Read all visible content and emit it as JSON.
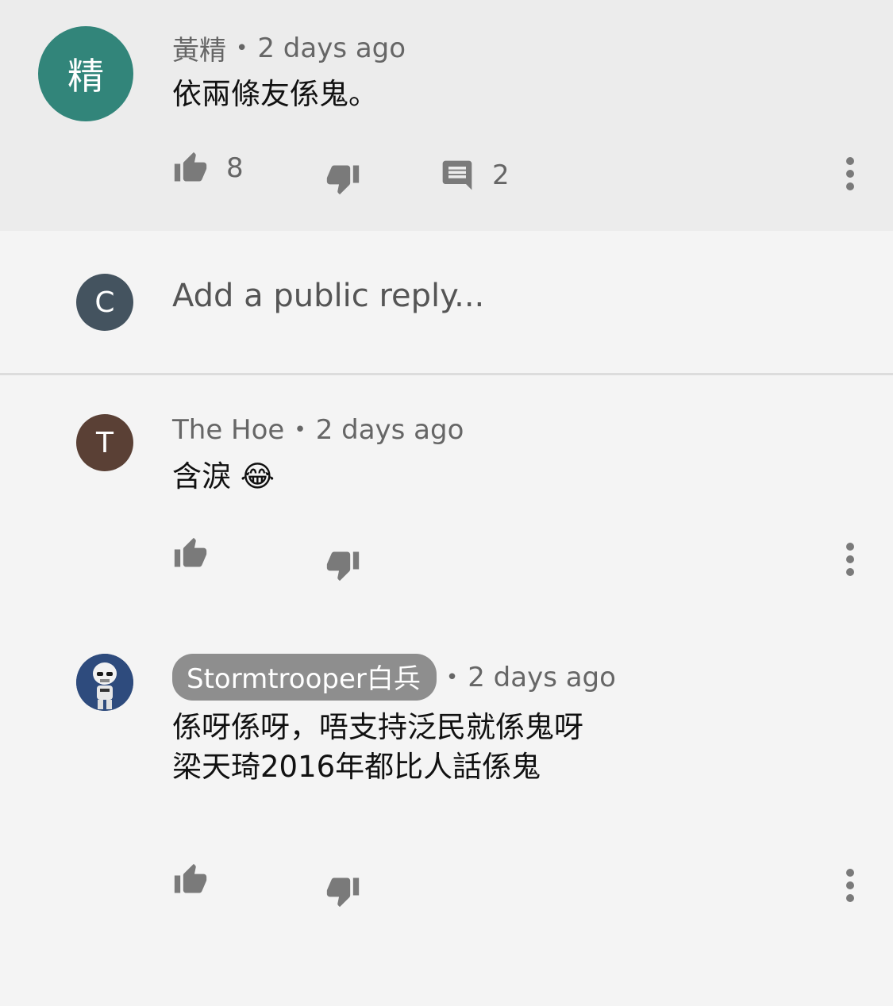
{
  "comments": [
    {
      "author": "黃精",
      "avatar_text": "精",
      "avatar_color": "#32857a",
      "time": "2 days ago",
      "text": "依兩條友係鬼。",
      "likes": "8",
      "replies": "2"
    },
    {
      "author": "The Hoe",
      "avatar_text": "T",
      "avatar_color": "#5a4035",
      "time": "2 days ago",
      "text": "含淚 😂"
    },
    {
      "author": "Stormtrooper白兵",
      "avatar_icon": "stormtrooper-avatar",
      "time": "2 days ago",
      "lines": [
        "係呀係呀，唔支持泛民就係鬼呀",
        "梁天琦2016年都比人話係鬼"
      ]
    }
  ],
  "reply_box": {
    "avatar_text": "C",
    "avatar_color": "#44535f",
    "placeholder": "Add a public reply..."
  },
  "separator": "•",
  "colors": {
    "icon_gray": "#7a7a7a",
    "highlight_bg": "#ececec",
    "page_bg": "#f4f4f4",
    "chip_bg": "#8e8e8e"
  },
  "icons": [
    "thumbs-up-icon",
    "thumbs-down-icon",
    "reply-icon",
    "more-vert-icon"
  ]
}
